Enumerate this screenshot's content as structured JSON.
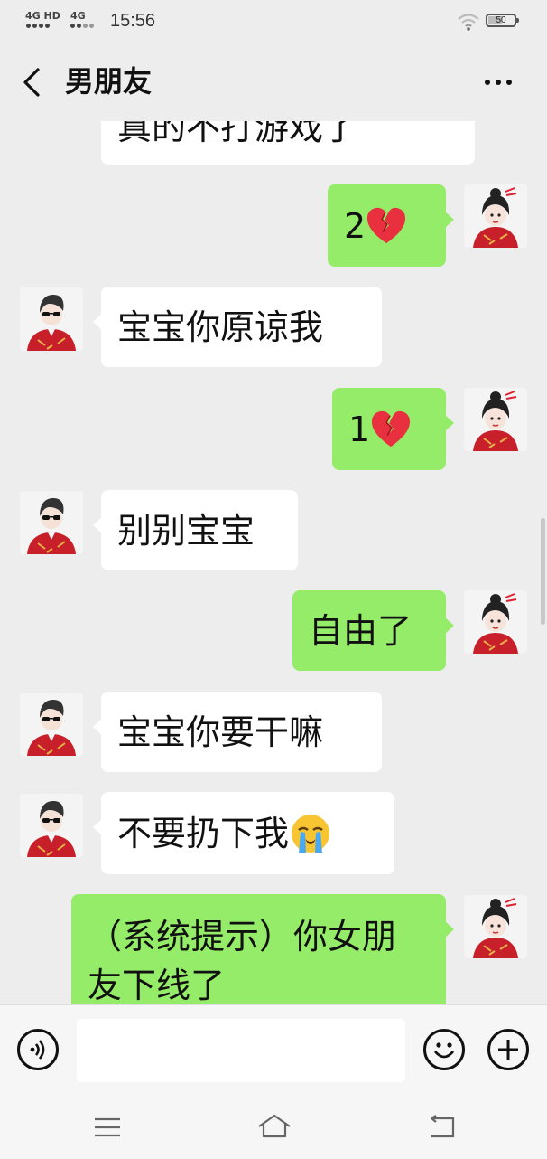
{
  "status_bar": {
    "signal1": "4G HD",
    "signal2": "4G",
    "time": "15:56",
    "battery": "50"
  },
  "header": {
    "title": "男朋友",
    "back_icon": "chevron-left-icon",
    "more_icon": "more-dots-icon"
  },
  "messages": [
    {
      "side": "in",
      "text": "真的不打游戏了"
    },
    {
      "side": "out",
      "text": "2",
      "emoji": "broken-heart"
    },
    {
      "side": "in",
      "text": "宝宝你原谅我"
    },
    {
      "side": "out",
      "text": "1",
      "emoji": "broken-heart"
    },
    {
      "side": "in",
      "text": "别别宝宝"
    },
    {
      "side": "out",
      "text": "自由了"
    },
    {
      "side": "in",
      "text": "宝宝你要干嘛"
    },
    {
      "side": "in",
      "text": "不要扔下我",
      "emoji": "loudly-crying-face"
    },
    {
      "side": "out",
      "text": "（系统提示）你女朋友下线了"
    }
  ],
  "input_bar": {
    "voice_icon": "voice-icon",
    "emoji_icon": "smiley-icon",
    "plus_icon": "plus-icon",
    "text": ""
  },
  "nav_bar": {
    "menu_icon": "menu-icon",
    "home_icon": "home-icon",
    "back_icon": "back-icon"
  },
  "colors": {
    "background": "#ededed",
    "outgoing_bubble": "#95ec69",
    "incoming_bubble": "#ffffff",
    "broken_heart": "#e8303e",
    "avatar_red": "#c8202a"
  }
}
